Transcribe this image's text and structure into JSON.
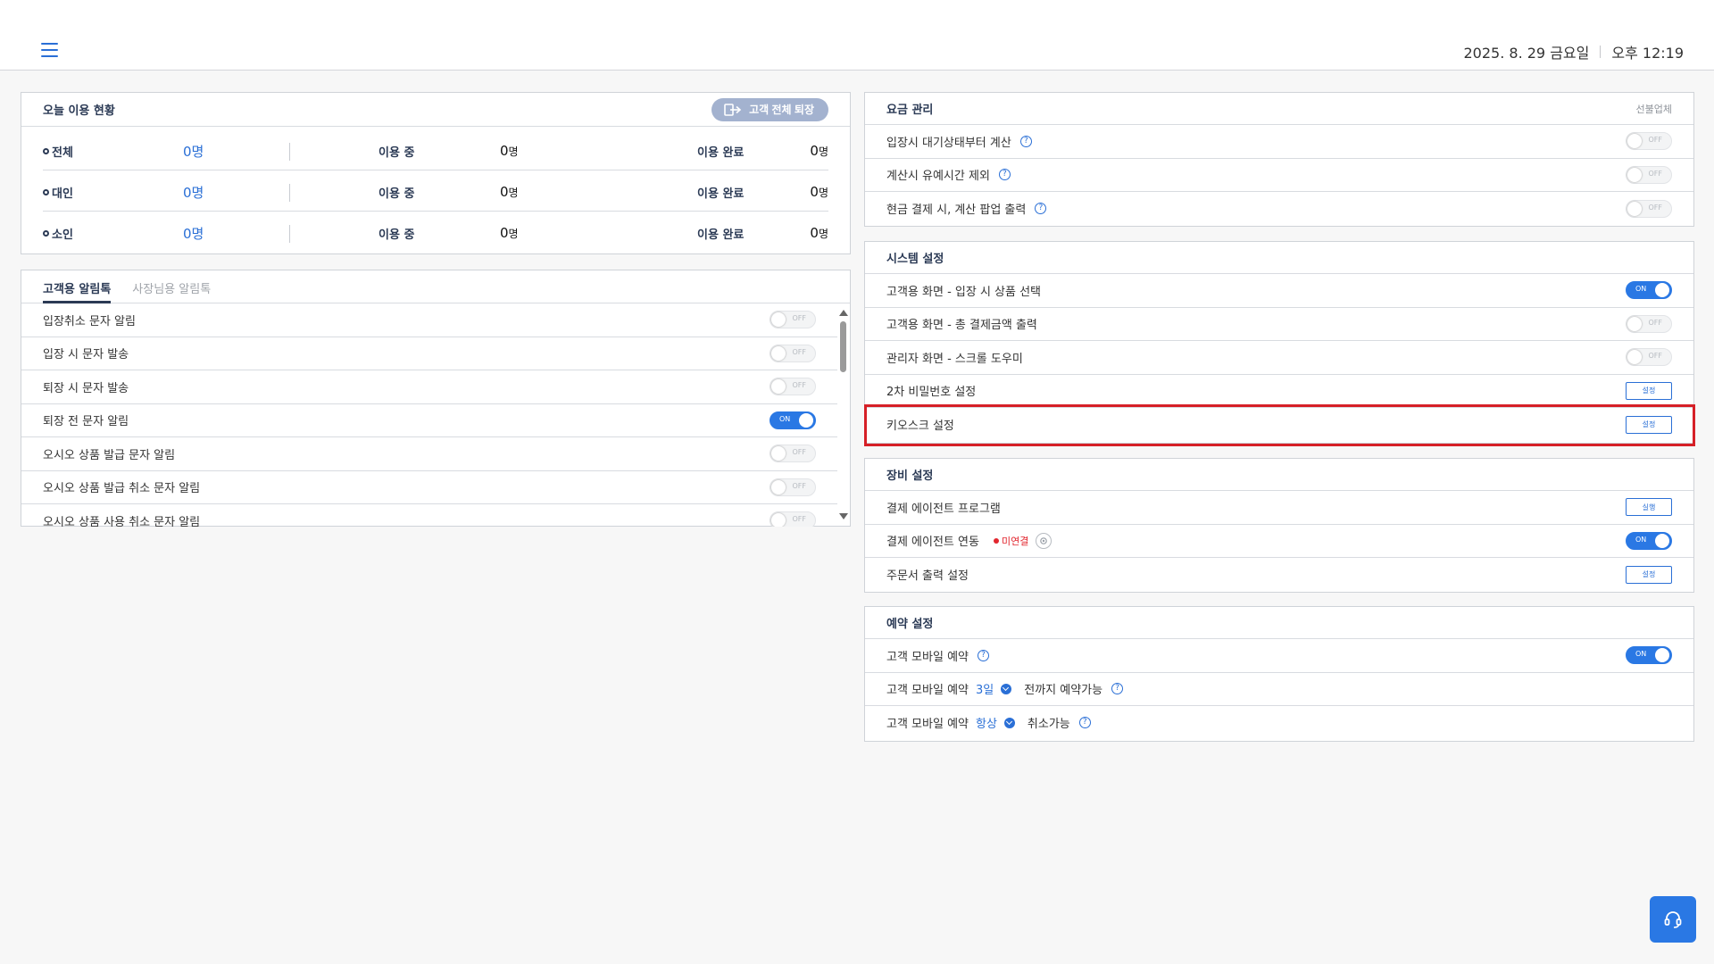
{
  "header": {
    "date": "2025. 8. 29 금요일",
    "time": "오후 12:19"
  },
  "today": {
    "title": "오늘 이용 현황",
    "exit_all_label": "고객 전체 퇴장",
    "rows": [
      {
        "label": "전체",
        "total": "0명",
        "in_use_label": "이용 중",
        "in_use_num": "0",
        "in_use_unit": "명",
        "done_label": "이용 완료",
        "done_num": "0",
        "done_unit": "명"
      },
      {
        "label": "대인",
        "total": "0명",
        "in_use_label": "이용 중",
        "in_use_num": "0",
        "in_use_unit": "명",
        "done_label": "이용 완료",
        "done_num": "0",
        "done_unit": "명"
      },
      {
        "label": "소인",
        "total": "0명",
        "in_use_label": "이용 중",
        "in_use_num": "0",
        "in_use_unit": "명",
        "done_label": "이용 완료",
        "done_num": "0",
        "done_unit": "명"
      }
    ]
  },
  "alim": {
    "tabs": [
      "고객용 알림톡",
      "사장님용 알림톡"
    ],
    "items": [
      {
        "label": "입장취소 문자 알림",
        "state": "OFF"
      },
      {
        "label": "입장 시 문자 발송",
        "state": "OFF"
      },
      {
        "label": "퇴장 시 문자 발송",
        "state": "OFF"
      },
      {
        "label": "퇴장 전 문자 알림",
        "state": "ON"
      },
      {
        "label": "오시오 상품 발급 문자 알림",
        "state": "OFF"
      },
      {
        "label": "오시오 상품 발급 취소 문자 알림",
        "state": "OFF"
      },
      {
        "label": "오시오 상품 사용 취소 문자 알림",
        "state": "OFF"
      }
    ]
  },
  "fee": {
    "title": "요금 관리",
    "link": "선불업체",
    "items": [
      {
        "label": "입장시 대기상태부터 계산",
        "state": "OFF"
      },
      {
        "label": "계산시 유예시간 제외",
        "state": "OFF"
      },
      {
        "label": "현금 결제 시, 계산 팝업 출력",
        "state": "OFF"
      }
    ]
  },
  "system": {
    "title": "시스템 설정",
    "items": [
      {
        "label": "고객용 화면 - 입장 시 상품 선택",
        "state": "ON"
      },
      {
        "label": "고객용 화면 - 총 결제금액 출력",
        "state": "OFF"
      },
      {
        "label": "관리자 화면 - 스크롤 도우미",
        "state": "OFF"
      },
      {
        "label": "2차 비밀번호 설정",
        "button": "설정"
      },
      {
        "label": "키오스크 설정",
        "button": "설정"
      }
    ]
  },
  "device": {
    "title": "장비 설정",
    "items": [
      {
        "label": "결제 에이전트 프로그램",
        "button": "실행"
      },
      {
        "label": "결제 에이전트 연동",
        "status": "미연결",
        "state": "ON"
      },
      {
        "label": "주문서 출력 설정",
        "button": "설정"
      }
    ]
  },
  "reserve": {
    "title": "예약 설정",
    "mobile_label": "고객 모바일 예약",
    "mobile_state": "ON",
    "days_prefix": "고객 모바일 예약",
    "days_value": "3일",
    "days_suffix": "전까지 예약가능",
    "cancel_prefix": "고객 모바일 예약",
    "cancel_value": "항상",
    "cancel_suffix": "취소가능"
  },
  "toggle_text": {
    "on": "ON",
    "off": "OFF"
  },
  "colors": {
    "accent": "#2a78e4",
    "highlight": "#d62027",
    "status_error": "#e2262e"
  }
}
